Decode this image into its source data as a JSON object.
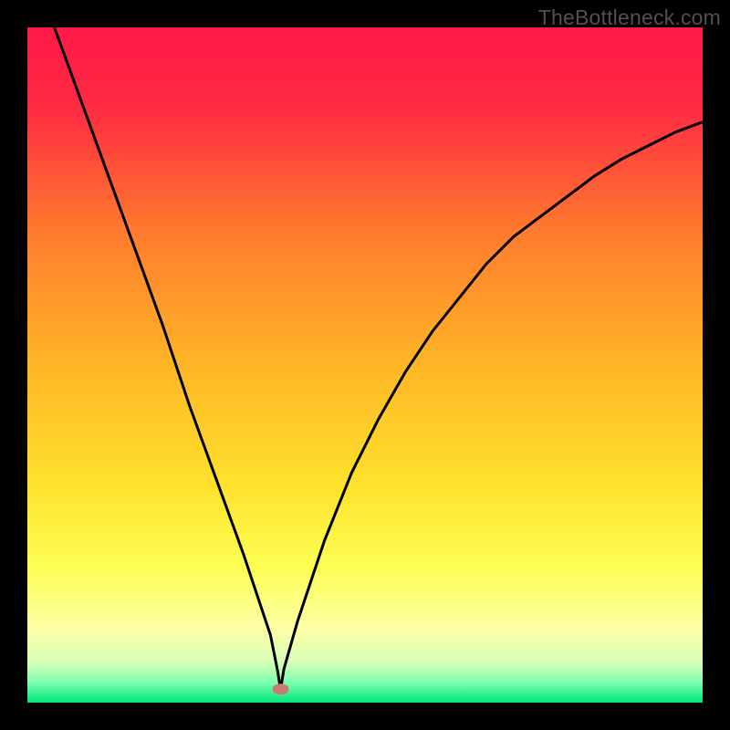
{
  "watermark": "TheBottleneck.com",
  "chart_data": {
    "type": "line",
    "title": "",
    "xlabel": "",
    "ylabel": "",
    "xlim": [
      0,
      100
    ],
    "ylim": [
      0,
      100
    ],
    "gradient_colors": {
      "top": "#ff1948",
      "upper_mid": "#ff8a2a",
      "mid": "#ffd626",
      "lower_mid": "#fcff54",
      "pale": "#fcffa6",
      "bottom": "#00e771"
    },
    "series": [
      {
        "name": "bottleneck-curve",
        "x": [
          4,
          8,
          12,
          16,
          20,
          24,
          28,
          32,
          34,
          36,
          37,
          37.5,
          38,
          40,
          44,
          48,
          52,
          56,
          60,
          64,
          68,
          72,
          76,
          80,
          84,
          88,
          92,
          96,
          100
        ],
        "y": [
          100,
          89,
          78,
          67,
          56,
          44,
          33,
          22,
          16,
          10,
          5,
          2,
          5,
          12,
          24,
          34,
          42,
          49,
          55,
          60,
          65,
          69,
          72,
          75,
          78,
          80.5,
          82.5,
          84.5,
          86
        ]
      }
    ],
    "marker": {
      "x": 37.5,
      "y": 2,
      "color": "#c77a72"
    }
  }
}
